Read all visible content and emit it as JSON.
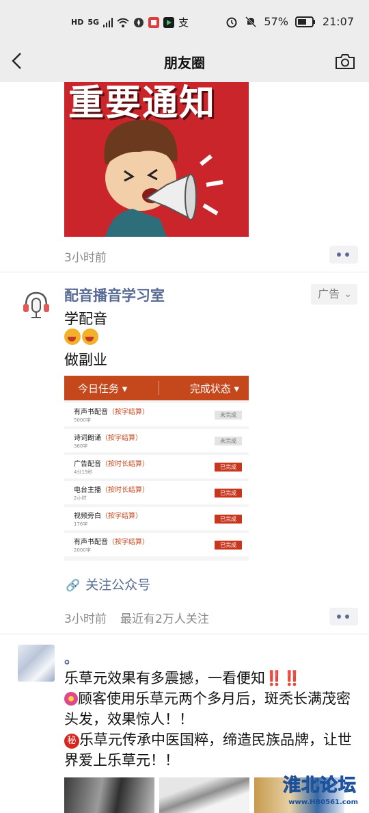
{
  "status_bar": {
    "hd_label": "HD",
    "network_label": "5G",
    "app_label": "支",
    "battery": "57%",
    "time": "21:07"
  },
  "nav": {
    "title": "朋友圈",
    "back_icon": "chevron-left-icon",
    "camera_icon": "camera-icon"
  },
  "post1": {
    "poster_text": "重要通知",
    "time": "3小时前"
  },
  "post2": {
    "author": "配音播音学习室",
    "ad_label": "广告",
    "lines": [
      "学配音",
      "做副业"
    ],
    "card": {
      "header_left": "今日任务 ▾",
      "header_right": "完成状态 ▾",
      "rows": [
        {
          "name": "有声书配音",
          "tag": "（按字结算）",
          "sub": "5000字",
          "status": "未完成",
          "done": false
        },
        {
          "name": "诗词朗诵",
          "tag": "（按字结算）",
          "sub": "360字",
          "status": "未完成",
          "done": false
        },
        {
          "name": "广告配音",
          "tag": "（按时长结算）",
          "sub": "4分19秒",
          "status": "已完成",
          "done": true
        },
        {
          "name": "电台主播",
          "tag": "（按时长结算）",
          "sub": "2小时",
          "status": "已完成",
          "done": true
        },
        {
          "name": "视频旁白",
          "tag": "（按字结算）",
          "sub": "176字",
          "status": "已完成",
          "done": true
        },
        {
          "name": "有声书配音",
          "tag": "（按字结算）",
          "sub": "2000字",
          "status": "已完成",
          "done": true
        }
      ]
    },
    "follow_label": "关注公众号",
    "time": "3小时前",
    "meta": "最近有2万人关注"
  },
  "post3": {
    "author": "。",
    "line1": "乐草元效果有多震撼，一看便知",
    "line1_marks": "‼️‼️",
    "line2": "顾客使用乐草元两个多月后，斑秃长满茂密头发，效果惊人！！",
    "secret_char": "秘",
    "line3": "乐草元传承中医国粹，缔造民族品牌，让世界爱上乐草元！！"
  },
  "watermark": {
    "title": "淮北论坛",
    "url": "www.HB0561.com"
  }
}
